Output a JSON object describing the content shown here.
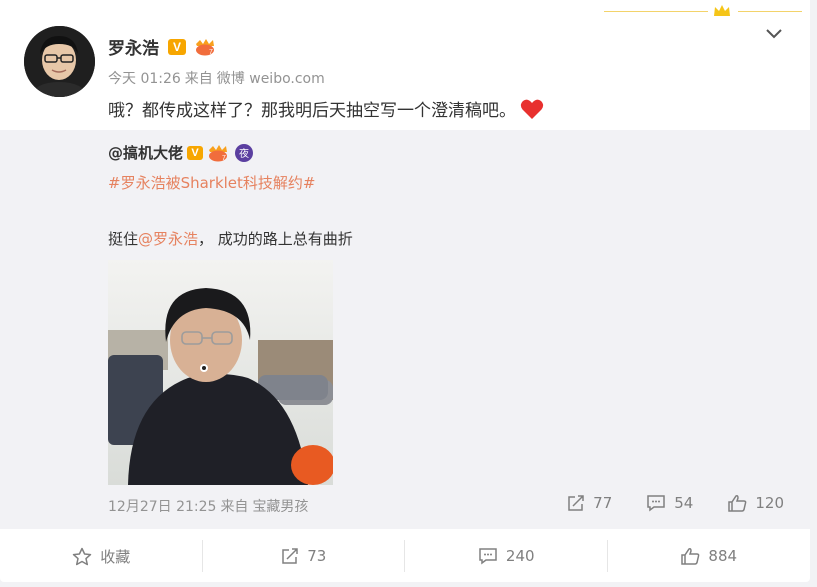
{
  "post": {
    "author": "罗永浩",
    "time": "今天 01:26",
    "source_prefix": "来自",
    "source": "微博 weibo.com",
    "text": "哦？都传成这样了？那我明后天抽空写一个澄清稿吧。"
  },
  "repost": {
    "author": "@搞机大佬",
    "hashtag": "#罗永浩被Sharklet科技解约#",
    "text_prefix": "挺住",
    "mention": "@罗永浩",
    "text_suffix": "， 成功的路上总有曲折",
    "time": "12月27日 21:25",
    "source_prefix": "来自",
    "source": "宝藏男孩",
    "reposts": "77",
    "comments": "54",
    "likes": "120"
  },
  "footer": {
    "favorite": "收藏",
    "reposts": "73",
    "comments": "240",
    "likes": "884"
  },
  "colors": {
    "link": "#e6825f",
    "vip": "#f7a600",
    "heart": "#e8302e"
  },
  "icons": [
    "chevron-down-icon",
    "crown-icon",
    "verified-icon",
    "member-icon",
    "heart-icon",
    "night-icon",
    "share-icon",
    "comment-icon",
    "like-icon",
    "star-icon"
  ]
}
